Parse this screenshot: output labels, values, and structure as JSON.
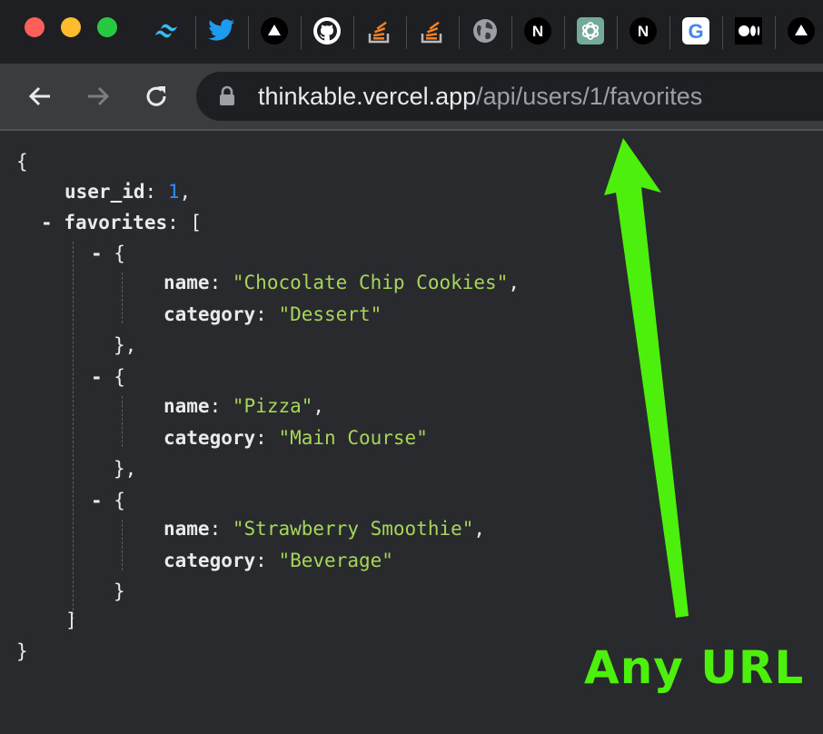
{
  "browser": {
    "bookmarks": [
      {
        "name": "tailwind-icon"
      },
      {
        "name": "twitter-icon"
      },
      {
        "name": "vercel-icon"
      },
      {
        "name": "github-icon"
      },
      {
        "name": "stackoverflow-icon"
      },
      {
        "name": "stackoverflow-icon"
      },
      {
        "name": "globe-icon"
      },
      {
        "name": "nextjs-icon",
        "glyph": "N"
      },
      {
        "name": "chatgpt-icon"
      },
      {
        "name": "nextjs-icon",
        "glyph": "N"
      },
      {
        "name": "google-icon",
        "glyph": "G"
      },
      {
        "name": "medium-icon",
        "glyph": "●●"
      },
      {
        "name": "vercel-icon"
      }
    ],
    "url_host": "thinkable.vercel.app",
    "url_path": "/api/users/1/favorites"
  },
  "json_view": {
    "open_brace": "{",
    "close_brace": "}",
    "user_id_key": "user_id",
    "user_id_value": "1",
    "favorites_key": "favorites",
    "collapse_toggle": "-",
    "items": [
      {
        "name": "Chocolate Chip Cookies",
        "category": "Dessert"
      },
      {
        "name": "Pizza",
        "category": "Main Course"
      },
      {
        "name": "Strawberry Smoothie",
        "category": "Beverage"
      }
    ]
  },
  "annotation": {
    "text": "Any URL",
    "color": "#4df00c"
  },
  "colors": {
    "background": "#292a2d",
    "string": "#a5d65a",
    "number": "#2f8bff"
  }
}
